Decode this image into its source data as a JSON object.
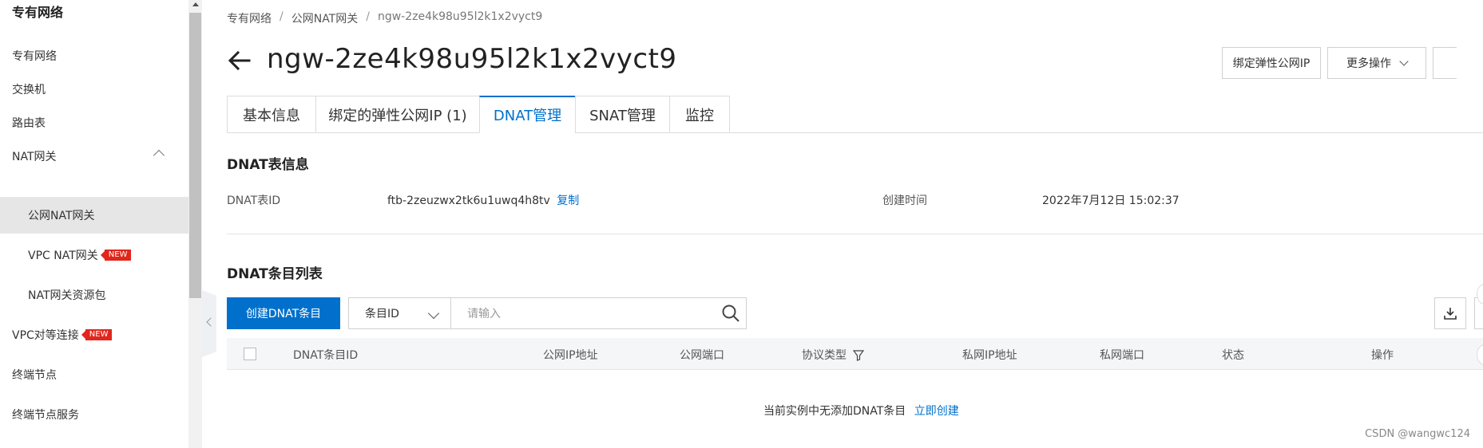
{
  "sidebar": {
    "title": "专有网络",
    "items": [
      {
        "label": "专有网络"
      },
      {
        "label": "交换机"
      },
      {
        "label": "路由表"
      },
      {
        "label": "NAT网关"
      },
      {
        "label": "公网NAT网关"
      },
      {
        "label": "VPC NAT网关",
        "badge": "NEW"
      },
      {
        "label": "NAT网关资源包"
      },
      {
        "label": "VPC对等连接",
        "badge": "NEW"
      },
      {
        "label": "终端节点"
      },
      {
        "label": "终端节点服务"
      }
    ]
  },
  "breadcrumb": {
    "items": [
      "专有网络",
      "公网NAT网关",
      "ngw-2ze4k98u95l2k1x2vyct9"
    ],
    "separator": "/"
  },
  "header": {
    "title": "ngw-2ze4k98u95l2k1x2vyct9",
    "bind_eip_button": "绑定弹性公网IP",
    "more_button": "更多操作"
  },
  "tabs": [
    {
      "label": "基本信息"
    },
    {
      "label": "绑定的弹性公网IP (1)"
    },
    {
      "label": "DNAT管理"
    },
    {
      "label": "SNAT管理"
    },
    {
      "label": "监控"
    }
  ],
  "active_tab": "DNAT管理",
  "dnat_info": {
    "section_title": "DNAT表信息",
    "id_label": "DNAT表ID",
    "id_value": "ftb-2zeuzwx2tk6u1uwq4h8tv",
    "copy_label": "复制",
    "created_label": "创建时间",
    "created_value": "2022年7月12日 15:02:37"
  },
  "dnat_list": {
    "section_title": "DNAT条目列表",
    "create_button": "创建DNAT条目",
    "filter_select": "条目ID",
    "search_placeholder": "请输入",
    "columns": [
      "DNAT条目ID",
      "公网IP地址",
      "公网端口",
      "协议类型",
      "私网IP地址",
      "私网端口",
      "状态",
      "操作"
    ],
    "empty_text": "当前实例中无添加DNAT条目",
    "empty_link": "立即创建"
  },
  "watermark": "CSDN @wangwc124",
  "colors": {
    "accent": "#0070cc",
    "badge": "#e1261c",
    "active_bg": "#e6e6e6"
  }
}
